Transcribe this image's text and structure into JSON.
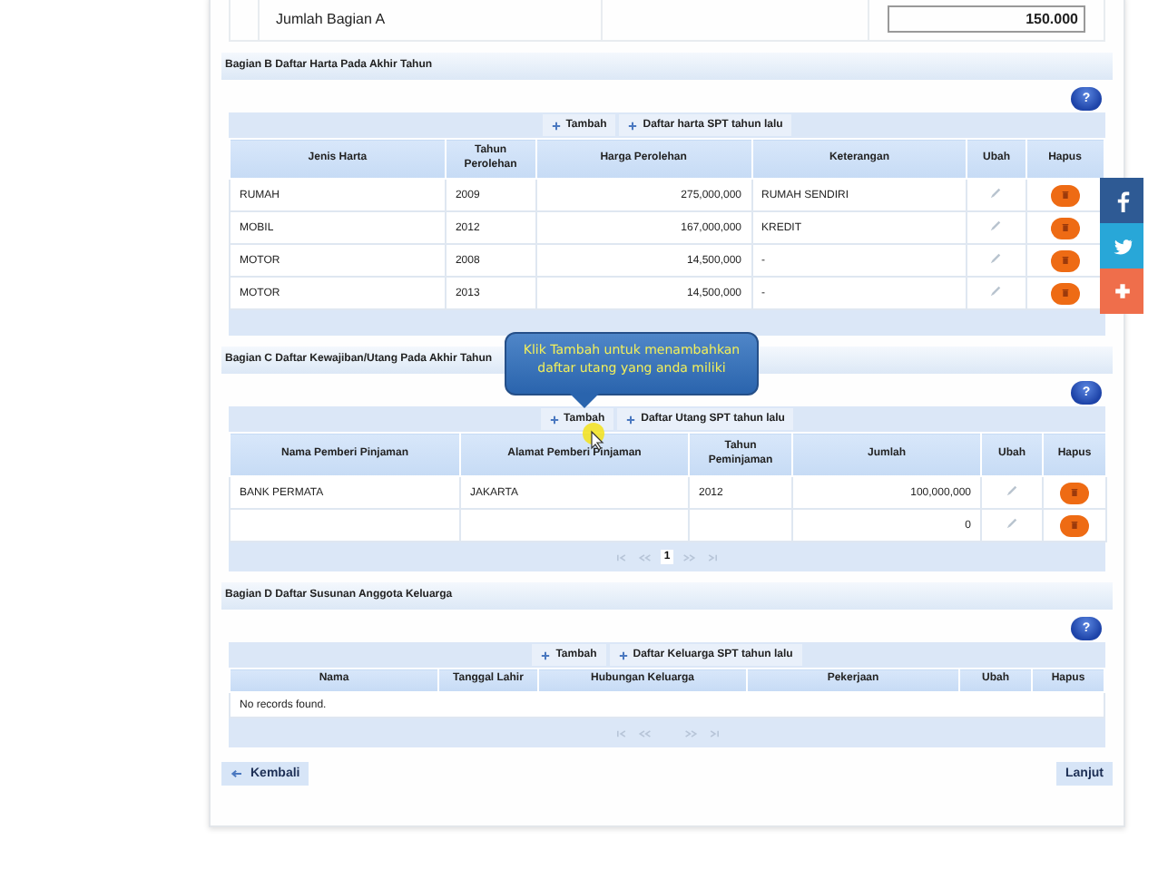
{
  "summary_row": {
    "label": "Jumlah Bagian A",
    "value": "150.000"
  },
  "sections": [
    {
      "title": "Bagian B Daftar Harta Pada Akhir Tahun",
      "toolbar": [
        "Tambah",
        "Daftar harta SPT tahun lalu"
      ],
      "columns": [
        {
          "label": "Jenis Harta",
          "kind": "text"
        },
        {
          "label": "Tahun Perolehan",
          "kind": "text"
        },
        {
          "label": "Harga Perolehan",
          "kind": "number"
        },
        {
          "label": "Keterangan",
          "kind": "text"
        },
        {
          "label": "Ubah",
          "kind": "edit"
        },
        {
          "label": "Hapus",
          "kind": "delete"
        }
      ],
      "rows": [
        [
          "RUMAH",
          "2009",
          "275,000,000",
          "RUMAH SENDIRI"
        ],
        [
          "MOBIL",
          "2012",
          "167,000,000",
          "KREDIT"
        ],
        [
          "MOTOR",
          "2008",
          "14,500,000",
          "-"
        ],
        [
          "MOTOR",
          "2013",
          "14,500,000",
          "-"
        ]
      ],
      "pager_shown": false
    },
    {
      "title": "Bagian C Daftar Kewajiban/Utang Pada Akhir Tahun",
      "toolbar": [
        "Tambah",
        "Daftar Utang SPT tahun lalu"
      ],
      "columns": [
        {
          "label": "Nama Pemberi Pinjaman",
          "kind": "text"
        },
        {
          "label": "Alamat Pemberi Pinjaman",
          "kind": "text"
        },
        {
          "label": "Tahun Peminjaman",
          "kind": "text"
        },
        {
          "label": "Jumlah",
          "kind": "number"
        },
        {
          "label": "Ubah",
          "kind": "edit"
        },
        {
          "label": "Hapus",
          "kind": "delete"
        }
      ],
      "rows": [
        [
          "BANK PERMATA",
          "JAKARTA",
          "2012",
          "100,000,000"
        ],
        [
          "",
          "",
          "",
          "0"
        ]
      ],
      "pager_shown": true,
      "pages": [
        {
          "label": "1",
          "selected": true
        }
      ]
    },
    {
      "title": "Bagian D Daftar Susunan Anggota Keluarga",
      "toolbar": [
        "Tambah",
        "Daftar Keluarga SPT tahun lalu"
      ],
      "columns": [
        {
          "label": "Nama",
          "kind": "text"
        },
        {
          "label": "Tanggal Lahir",
          "kind": "text"
        },
        {
          "label": "Hubungan Keluarga",
          "kind": "text"
        },
        {
          "label": "Pekerjaan",
          "kind": "text"
        },
        {
          "label": "Ubah",
          "kind": "edit"
        },
        {
          "label": "Hapus",
          "kind": "delete"
        }
      ],
      "empty_message": "No records found.",
      "pager_shown": true
    }
  ],
  "help_button": "?",
  "back_button": "Kembali",
  "next_button": "Lanjut",
  "tooltip": "Klik Tambah untuk menambahkan daftar utang yang anda miliki"
}
